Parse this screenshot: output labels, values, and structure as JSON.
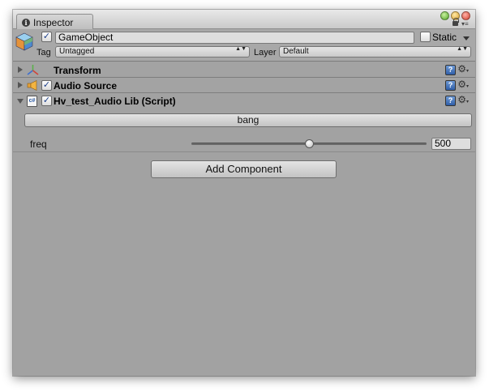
{
  "window": {
    "tab_label": "Inspector",
    "menu_glyph": "▾≡"
  },
  "header": {
    "object_name": "GameObject",
    "active_check": "✓",
    "static_label": "Static",
    "tag_label": "Tag",
    "tag_value": "Untagged",
    "layer_label": "Layer",
    "layer_value": "Default",
    "dropdown_arrows": "▲▼"
  },
  "components": [
    {
      "title": "Transform",
      "has_checkbox": false,
      "expanded": false
    },
    {
      "title": "Audio Source",
      "has_checkbox": true,
      "enabled_check": "✓",
      "expanded": false
    },
    {
      "title": "Hv_test_Audio Lib (Script)",
      "has_checkbox": true,
      "enabled_check": "✓",
      "expanded": true
    }
  ],
  "component_icons": {
    "help_glyph": "?",
    "cog_glyph": "⚙",
    "cog_arrow": "▾",
    "script_glyph": "c#"
  },
  "script": {
    "bang_label": "bang",
    "freq_label": "freq",
    "freq_value": "500",
    "freq_slider_fraction": 0.5
  },
  "add_component_label": "Add Component",
  "colors": {
    "panel": "#a2a2a2",
    "check": "#1c3f8a",
    "help": "#2f5ea8"
  }
}
